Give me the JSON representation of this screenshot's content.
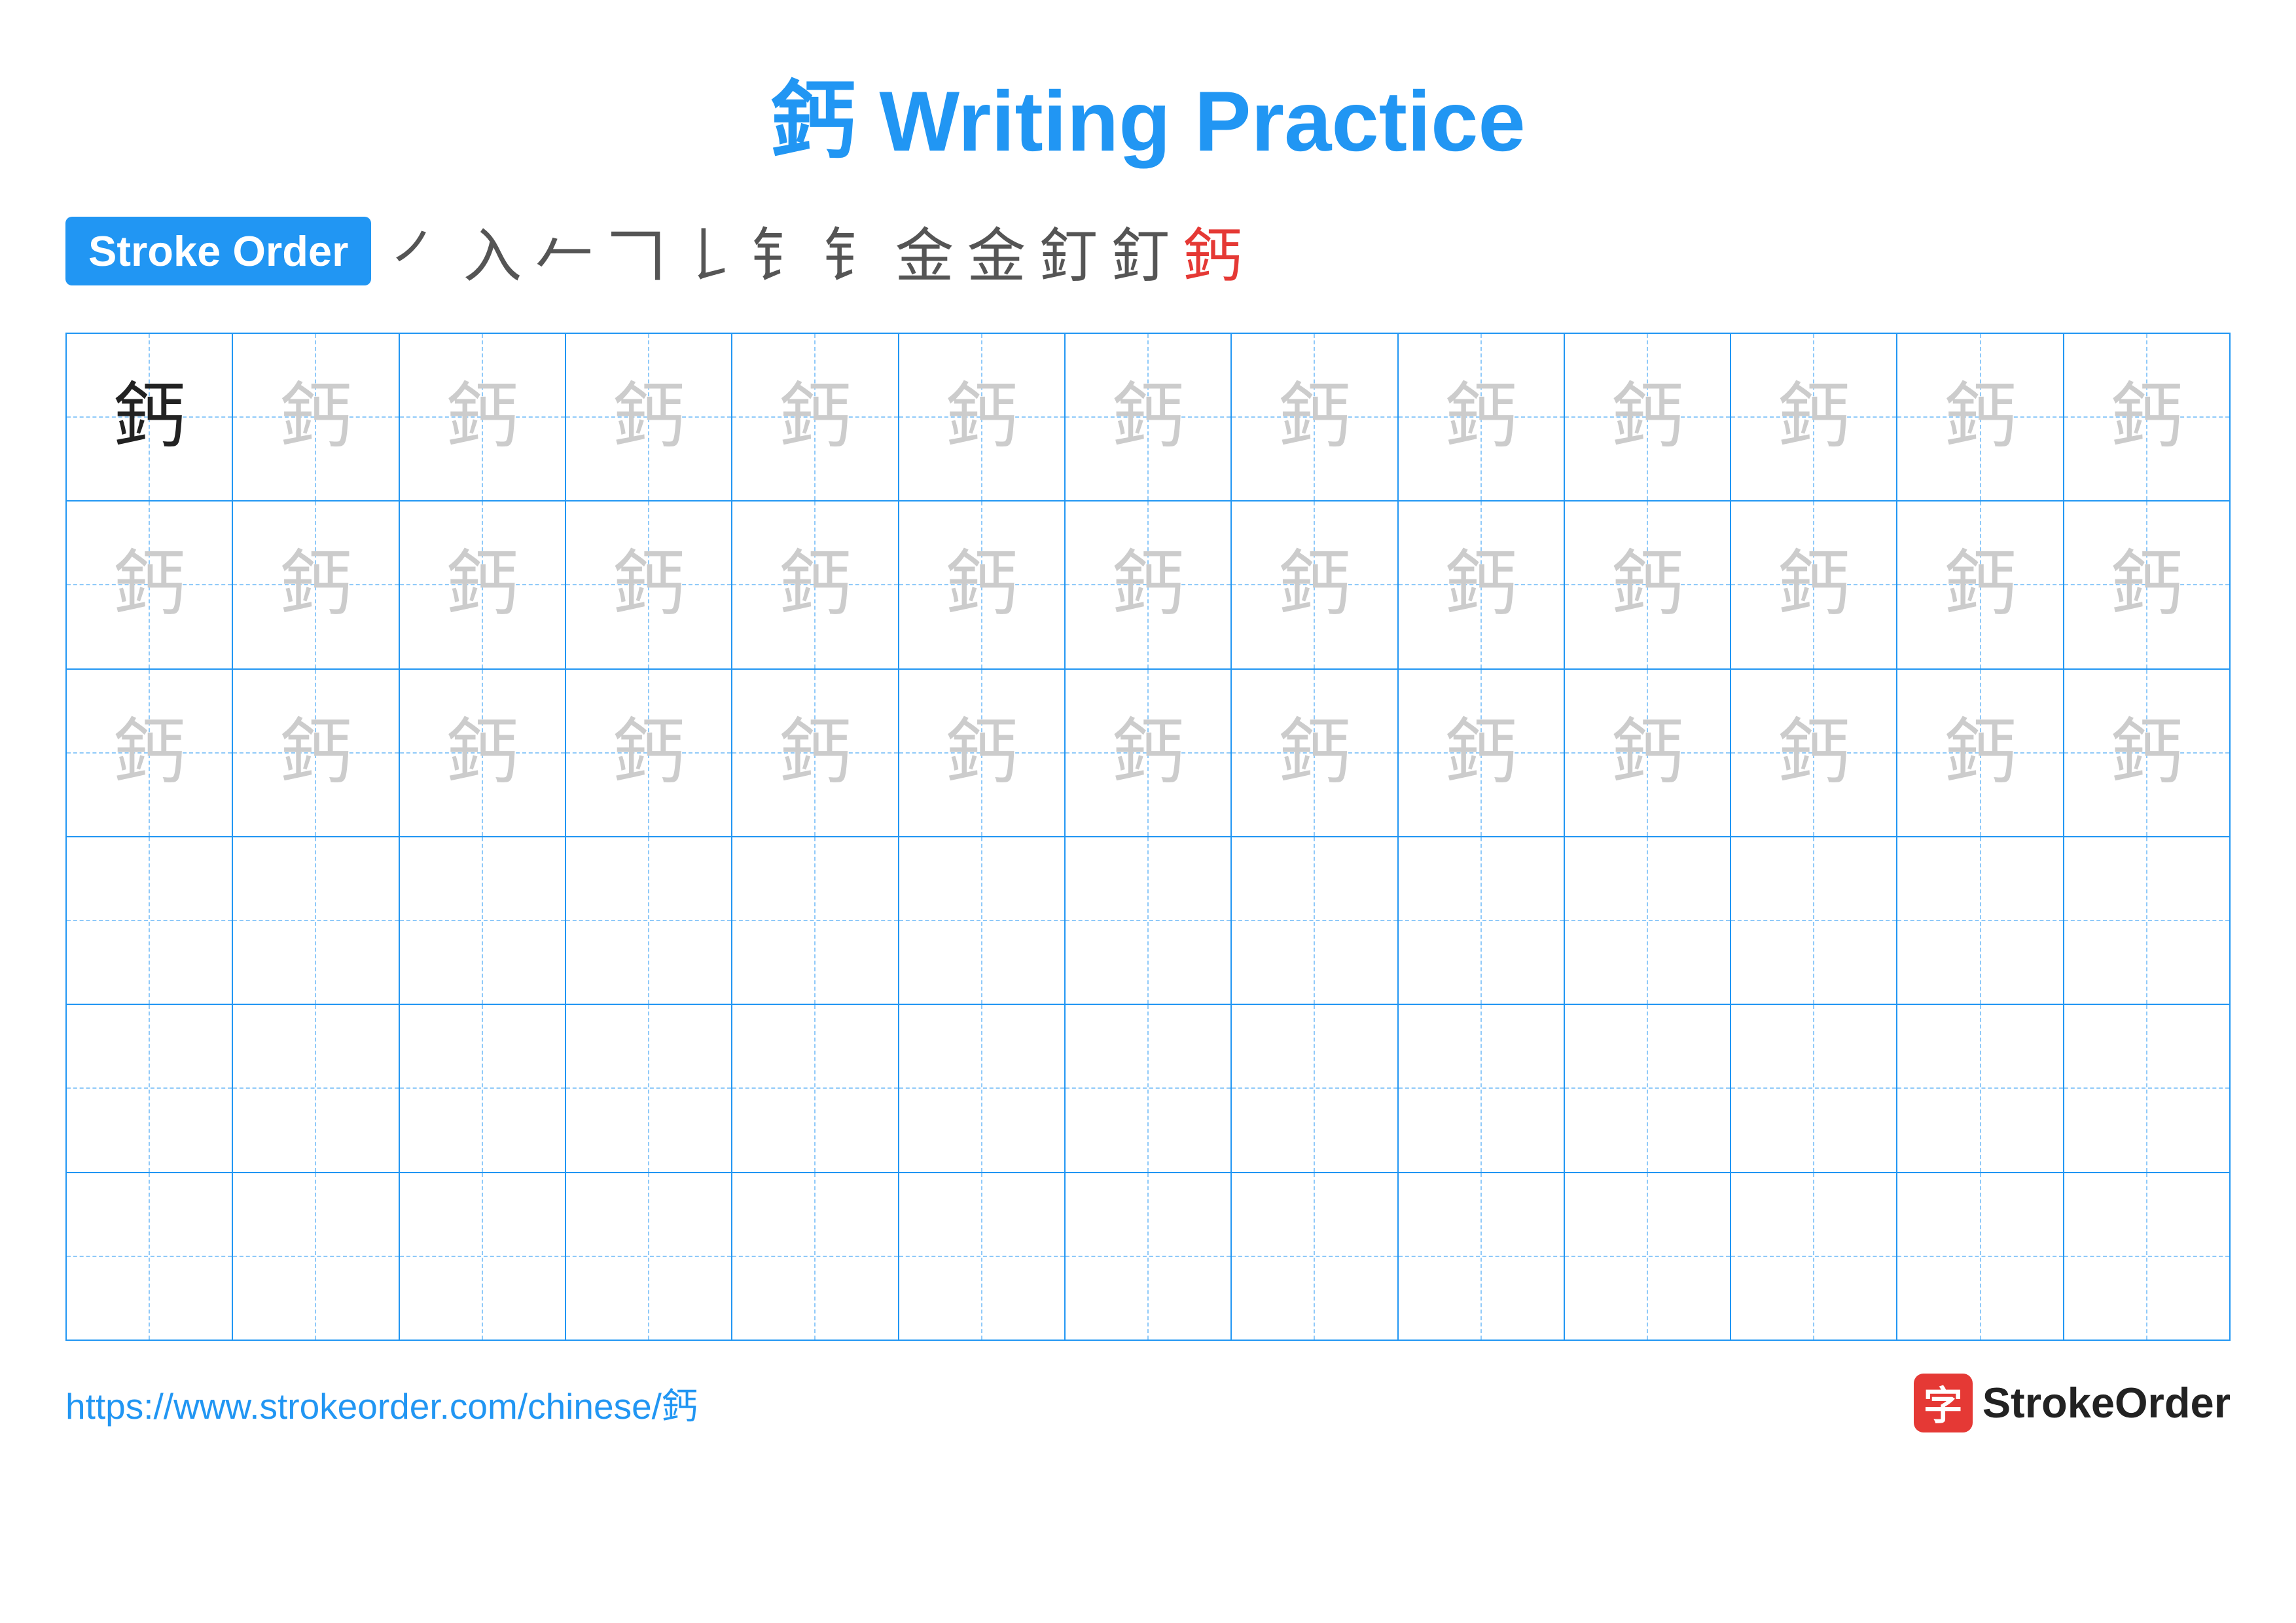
{
  "title": "鈣 Writing Practice",
  "stroke_order": {
    "badge_label": "Stroke Order",
    "strokes": [
      "㇒",
      "入",
      "⺈",
      "𠃍",
      "𠃋",
      "钅",
      "钅",
      "金",
      "金",
      "釘",
      "釘",
      "鈣"
    ]
  },
  "character": "鈣",
  "rows": [
    {
      "type": "dark_first",
      "count": 13
    },
    {
      "type": "light",
      "count": 13
    },
    {
      "type": "light",
      "count": 13
    },
    {
      "type": "empty",
      "count": 13
    },
    {
      "type": "empty",
      "count": 13
    },
    {
      "type": "empty",
      "count": 13
    }
  ],
  "footer": {
    "url": "https://www.strokeorder.com/chinese/鈣",
    "logo_text": "StrokeOrder",
    "logo_char": "字"
  }
}
